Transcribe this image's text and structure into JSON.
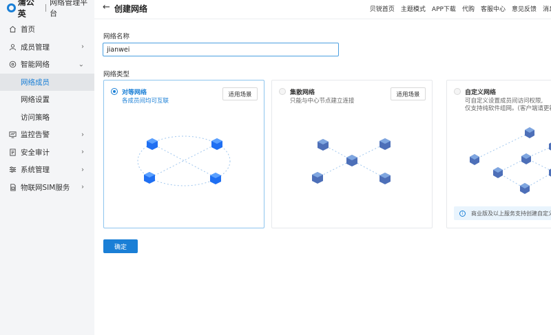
{
  "brand": {
    "name": "蒲公英",
    "subtitle": "网络管理平台"
  },
  "sidebar": {
    "items": [
      {
        "label": "首页",
        "icon": "home-icon"
      },
      {
        "label": "成员管理",
        "icon": "user-icon",
        "chevron": "›"
      },
      {
        "label": "智能网络",
        "icon": "network-icon",
        "chevron": "⌄"
      },
      {
        "label": "网络成员",
        "sub": true,
        "active": true
      },
      {
        "label": "网络设置",
        "sub": true
      },
      {
        "label": "访问策略",
        "sub": true
      },
      {
        "label": "监控告警",
        "icon": "monitor-icon",
        "chevron": "›"
      },
      {
        "label": "安全审计",
        "icon": "audit-icon",
        "chevron": "›"
      },
      {
        "label": "系统管理",
        "icon": "settings-icon",
        "chevron": "›"
      },
      {
        "label": "物联网SIM服务",
        "icon": "sim-icon",
        "chevron": "›"
      }
    ]
  },
  "header": {
    "back": "←",
    "title": "创建网络",
    "links": [
      "贝锐首页",
      "主题模式",
      "APP下载",
      "代购",
      "客服中心",
      "意见反馈",
      "消息"
    ]
  },
  "form": {
    "name_label": "网络名称",
    "name_value": "jianwei",
    "type_label": "网络类型",
    "cards": [
      {
        "title": "对等网络",
        "desc": "各成员间均可互联",
        "desc2": "",
        "button": "适用场景",
        "selected": true
      },
      {
        "title": "集散网络",
        "desc": "只能与中心节点建立连接",
        "desc2": "",
        "button": "适用场景",
        "selected": false
      },
      {
        "title": "自定义网络",
        "desc": "可自定义设置成员间访问权限,",
        "desc2": "仅支持纯软件组网。(客户端请更新至最",
        "button": "",
        "selected": false,
        "notice": "商业版及以上服务支持创建自定义网"
      }
    ],
    "confirm": "确定"
  },
  "colors": {
    "accent": "#1a7fd6",
    "sidebar_bg": "#f4f5f7",
    "active_bg": "#e3e5e8"
  }
}
